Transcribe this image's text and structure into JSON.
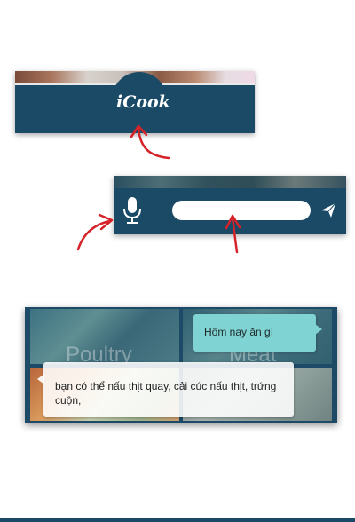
{
  "footer": {
    "logo_text": "iCook"
  },
  "input_bar": {
    "mic_icon": "microphone-icon",
    "send_icon": "send-icon",
    "value": "",
    "placeholder": ""
  },
  "categories": [
    {
      "label": "Poultry"
    },
    {
      "label": "Meat"
    }
  ],
  "chat": {
    "reply": "Hôm nay ăn gì",
    "message": "bạn có thể nấu thịt quay, cải cúc nấu thịt, trứng cuộn,"
  },
  "colors": {
    "brand": "#1b4a66",
    "reply_bubble": "#7fd3d3",
    "annotation": "#d6232a"
  }
}
